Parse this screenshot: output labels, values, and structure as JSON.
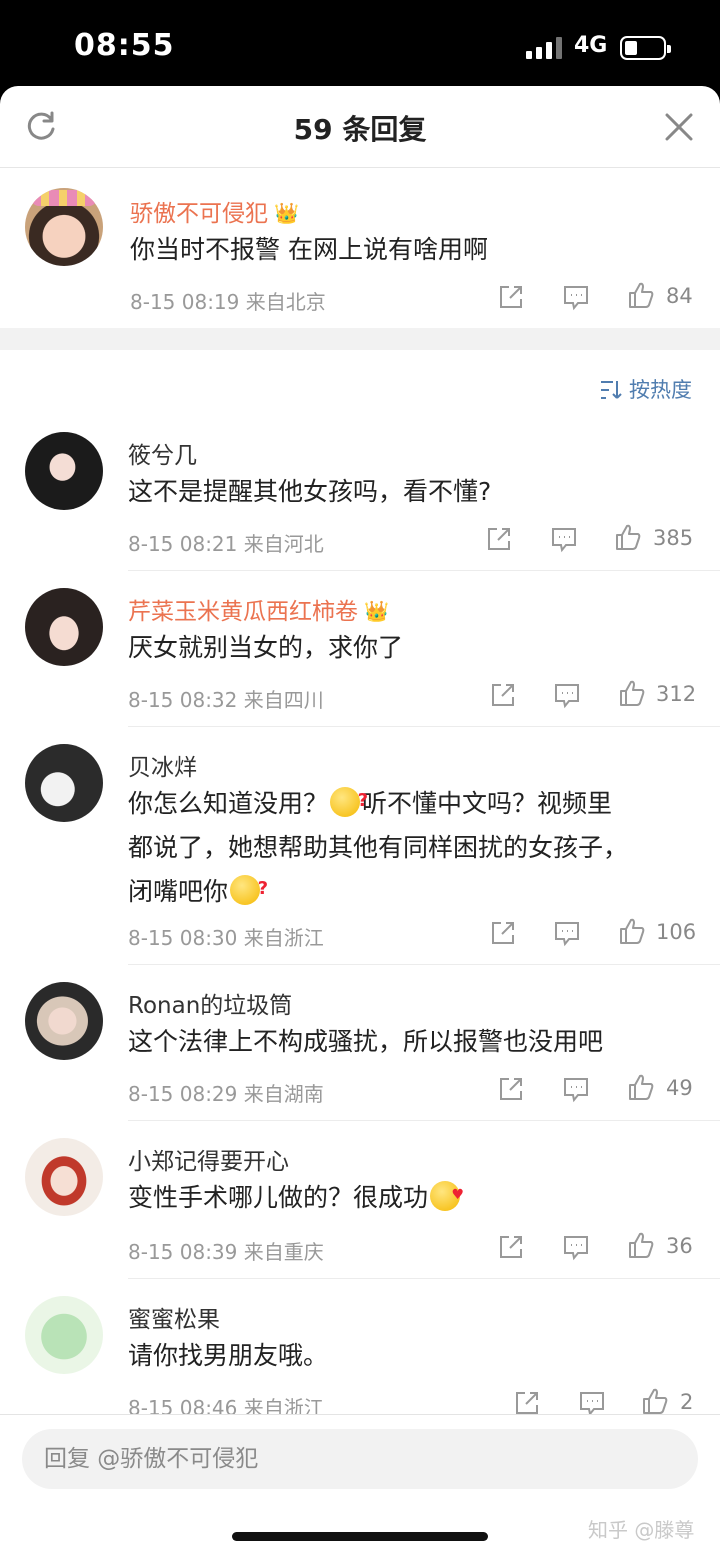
{
  "status_bar": {
    "time": "08:55",
    "network": "4G"
  },
  "header": {
    "title": "59 条回复",
    "refresh_icon": "refresh-icon",
    "close_icon": "close-icon"
  },
  "main_comment": {
    "user": "骄傲不可侵犯",
    "vip": true,
    "text": "你当时不报警 在网上说有啥用啊",
    "meta": "8-15 08:19  来自北京",
    "likes": "84"
  },
  "sort": {
    "label": "按热度"
  },
  "replies": [
    {
      "user": "筱兮几",
      "vip": false,
      "lines": [
        "这不是提醒其他女孩吗，看不懂?"
      ],
      "meta": "8-15 08:21  来自河北",
      "likes": "385"
    },
    {
      "user": "芹菜玉米黄瓜西红柿卷",
      "vip": true,
      "lines": [
        "厌女就别当女的，求你了"
      ],
      "meta": "8-15 08:32  来自四川",
      "likes": "312"
    },
    {
      "user": "贝冰烊",
      "vip": false,
      "lines": [
        "你怎么知道没用？",
        "听不懂中文吗？视频里",
        "都说了，她想帮助其他有同样困扰的女孩子，",
        "闭嘴吧你"
      ],
      "meta": "8-15 08:30  来自浙江",
      "likes": "106"
    },
    {
      "user": "Ronan的垃圾筒",
      "vip": false,
      "lines": [
        "这个法律上不构成骚扰，所以报警也没用吧"
      ],
      "meta": "8-15 08:29  来自湖南",
      "likes": "49"
    },
    {
      "user": "小郑记得要开心",
      "vip": false,
      "lines": [
        "变性手术哪儿做的？很成功"
      ],
      "meta": "8-15 08:39  来自重庆",
      "likes": "36"
    },
    {
      "user": "蜜蜜松果",
      "vip": false,
      "lines": [
        "请你找男朋友哦。"
      ],
      "meta": "8-15 08:46  来自浙江",
      "likes": "2"
    }
  ],
  "input": {
    "placeholder": "回复 @骄傲不可侵犯"
  },
  "watermark": "知乎 @滕尊",
  "colors": {
    "vip_name": "#eb7350",
    "link_blue": "#507daf",
    "text": "#222222",
    "meta": "#999999"
  }
}
